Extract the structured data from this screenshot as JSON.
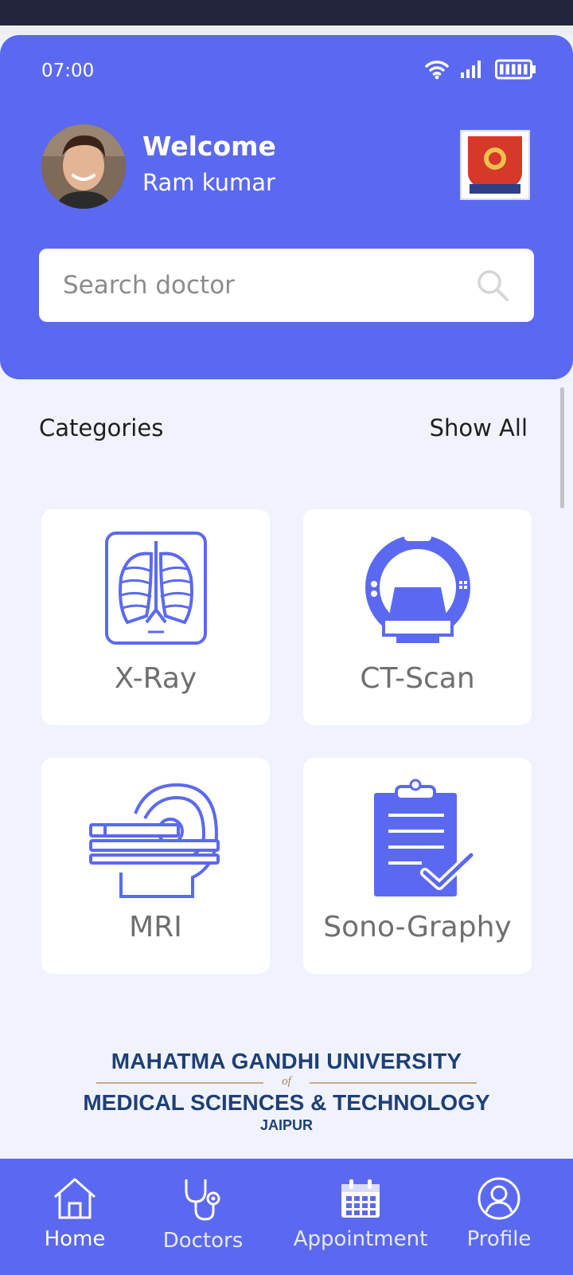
{
  "status": {
    "time": "07:00"
  },
  "header": {
    "welcome": "Welcome",
    "user_name": "Ram kumar"
  },
  "search": {
    "placeholder": "Search doctor"
  },
  "categories": {
    "title": "Categories",
    "show_all": "Show All",
    "items": [
      {
        "label": "X-Ray",
        "icon": "xray-chest-icon"
      },
      {
        "label": "CT-Scan",
        "icon": "ct-scanner-icon"
      },
      {
        "label": "MRI",
        "icon": "mri-machine-icon"
      },
      {
        "label": "Sono-Graphy",
        "icon": "clipboard-check-icon"
      }
    ]
  },
  "university": {
    "line1": "MAHATMA GANDHI UNIVERSITY",
    "of": "of",
    "line2": "MEDICAL SCIENCES & TECHNOLOGY",
    "line3": "JAIPUR"
  },
  "nav": {
    "items": [
      {
        "label": "Home",
        "icon": "home-icon",
        "active": true
      },
      {
        "label": "Doctors",
        "icon": "stethoscope-icon"
      },
      {
        "label": "Appointment",
        "icon": "calendar-icon"
      },
      {
        "label": "Profile",
        "icon": "user-circle-icon"
      }
    ]
  },
  "colors": {
    "primary": "#5b69f0",
    "background": "#f0f3fd",
    "icon": "#5b69f0"
  }
}
